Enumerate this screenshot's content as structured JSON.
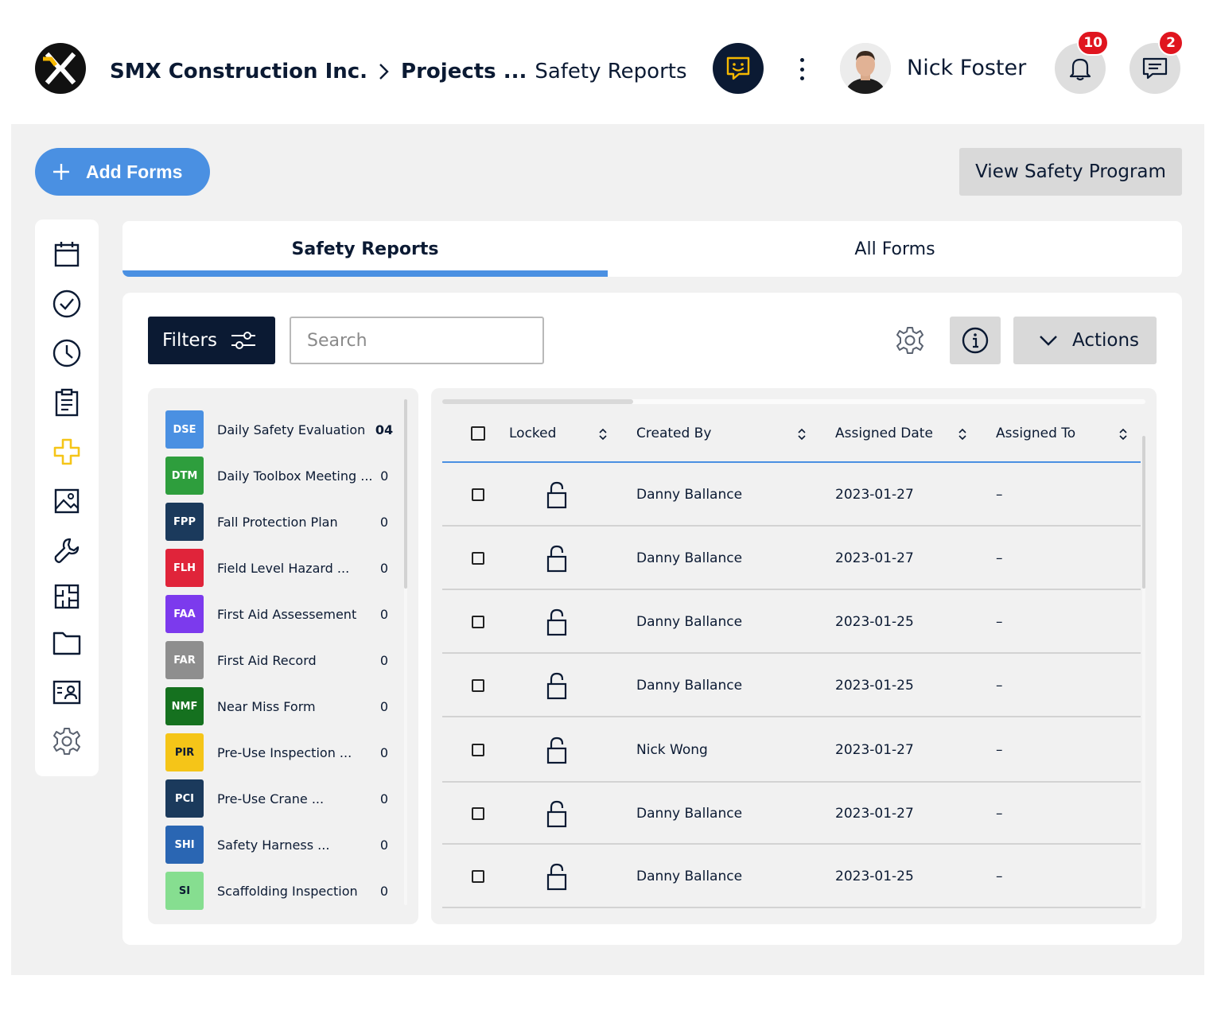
{
  "header": {
    "company": "SMX Construction Inc.",
    "projects": "Projects ...",
    "current_page": "Safety Reports",
    "user_name": "Nick Foster",
    "notifications_count": "10",
    "messages_count": "2"
  },
  "toolbar": {
    "add_forms_label": "Add Forms",
    "view_program_label": "View Safety Program"
  },
  "tabs": [
    {
      "label": "Safety Reports",
      "active": true
    },
    {
      "label": "All Forms",
      "active": false
    }
  ],
  "panel": {
    "filters_label": "Filters",
    "search_placeholder": "Search",
    "actions_label": "Actions"
  },
  "forms": [
    {
      "code": "DSE",
      "name": "Daily Safety Evaluation",
      "count": "04",
      "color": "#4a90e2"
    },
    {
      "code": "DTM",
      "name": "Daily Toolbox Meeting ...",
      "count": "0",
      "color": "#2e9e3d"
    },
    {
      "code": "FPP",
      "name": "Fall Protection Plan",
      "count": "0",
      "color": "#1b3a5c"
    },
    {
      "code": "FLH",
      "name": "Field Level Hazard ...",
      "count": "0",
      "color": "#e0243a"
    },
    {
      "code": "FAA",
      "name": "First Aid Assessement",
      "count": "0",
      "color": "#7c3aed"
    },
    {
      "code": "FAR",
      "name": "First Aid Record",
      "count": "0",
      "color": "#8e8e8e"
    },
    {
      "code": "NMF",
      "name": "Near Miss Form",
      "count": "0",
      "color": "#15711f"
    },
    {
      "code": "PIR",
      "name": "Pre-Use Inspection ...",
      "count": "0",
      "color": "#f5c518"
    },
    {
      "code": "PCI",
      "name": "Pre-Use Crane ...",
      "count": "0",
      "color": "#1b3a5c"
    },
    {
      "code": "SHI",
      "name": "Safety Harness ...",
      "count": "0",
      "color": "#2a66b3"
    },
    {
      "code": "SI",
      "name": "Scaffolding Inspection",
      "count": "0",
      "color": "#86de90"
    }
  ],
  "table": {
    "columns": [
      "Locked",
      "Created By",
      "Assigned Date",
      "Assigned To"
    ],
    "rows": [
      {
        "created_by": "Danny Ballance",
        "assigned_date": "2023-01-27",
        "assigned_to": "–"
      },
      {
        "created_by": "Danny Ballance",
        "assigned_date": "2023-01-27",
        "assigned_to": "–"
      },
      {
        "created_by": "Danny Ballance",
        "assigned_date": "2023-01-25",
        "assigned_to": "–"
      },
      {
        "created_by": "Danny Ballance",
        "assigned_date": "2023-01-25",
        "assigned_to": "–"
      },
      {
        "created_by": "Nick Wong",
        "assigned_date": "2023-01-27",
        "assigned_to": "–"
      },
      {
        "created_by": "Danny Ballance",
        "assigned_date": "2023-01-27",
        "assigned_to": "–"
      },
      {
        "created_by": "Danny Ballance",
        "assigned_date": "2023-01-25",
        "assigned_to": "–"
      }
    ]
  },
  "nav_icons": [
    "calendar-icon",
    "check-circle-icon",
    "clock-icon",
    "clipboard-icon",
    "plus-cross-icon",
    "image-icon",
    "wrench-icon",
    "floor-plan-icon",
    "folder-icon",
    "contact-card-icon",
    "gear-icon"
  ],
  "colors": {
    "accent": "#4a90e2",
    "navy": "#0b1a33",
    "badge": "#e0151f",
    "active_nav": "#f5c518"
  }
}
